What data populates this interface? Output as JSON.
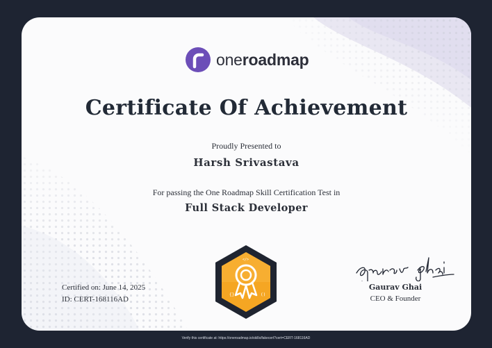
{
  "brand": {
    "name_part1": "one",
    "name_part2": "roadmap",
    "logo_icon": "roadmap-r-logo-icon",
    "logo_color": "#6c4eb8"
  },
  "certificate": {
    "title": "Certificate Of Achievement",
    "presented_label": "Proudly Presented to",
    "recipient": "Harsh Srivastava",
    "passing_text": "For passing the One Roadmap Skill Certification Test in",
    "course": "Full Stack Developer",
    "certified_on": "Certified on: June 14, 2025",
    "id": "ID: CERT-168116AD"
  },
  "badge": {
    "icon": "award-ribbon-icon",
    "fill_color": "#f5a623",
    "frame_color": "#1f2430"
  },
  "signature": {
    "name": "Gaurav Ghai",
    "role": "CEO & Founder"
  },
  "footer": {
    "verify_text": "Verify this certificate at: https://oneroadmap.io/skills/fakecert?cert=CERT-168116AD"
  },
  "colors": {
    "background": "#1e2432",
    "card": "#fbfbfc",
    "text": "#222a36"
  }
}
